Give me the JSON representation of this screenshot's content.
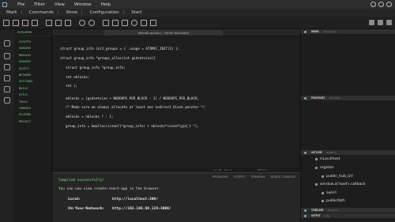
{
  "menubar": {
    "items": [
      "File",
      "Filter",
      "View",
      "Window",
      "Help"
    ]
  },
  "commandbar": {
    "items": [
      "Mark",
      "Commands",
      "Show",
      "Configuration",
      "Start"
    ]
  },
  "explorer": {
    "header": "EXPLORER",
    "items": [
      "SCRIPTS",
      "SHADERS",
      "MODULES",
      "SHADERS",
      "ASSETS",
      "NETWORK",
      "SETTINGS",
      "BUILD",
      "UTILS",
      "TOOLS",
      "CONSOLE",
      "PLUGINS",
      "PROJECT"
    ]
  },
  "editor": {
    "tab_title": "allocate-groups.c - kernel workspace",
    "lines": [
      "struct group_info init_groups = { .usage = ATOMIC_INIT(2) };",
      "struct group_info *groups_alloc(int gidsetsize){",
      "struct group_info *group_info;",
      "int nblocks;",
      "int i;",
      "nblocks = (gidsetsize + NGROUPS_PER_BLOCK - 1) / NGROUPS_PER_BLOCK;",
      "/* Make sure we always allocate at least one indirect block pointer */",
      "nblocks = nblocks ? : 1;",
      "group_info = kmalloc(sizeof(*group_info) + nblocks*sizeof(gid_t *),"
    ]
  },
  "status": {
    "left": "Ln 12, Col 4",
    "right": "UTF-8  C"
  },
  "panel": {
    "tabs": [
      "PROBLEMS",
      "OUTPUT",
      "TERMINAL",
      "DEBUG CONSOLE"
    ],
    "success": "Compiled successfully!",
    "message": "You can now view create-react-app in the browser.",
    "local_label": "Local:",
    "local_url": "http://localhost:300/",
    "network_label": "On Your Network:",
    "network_url": "http://192.168.98.138:3000/"
  },
  "rightpanel": {
    "sections": [
      {
        "title": "DEBUG",
        "sub": "Variables"
      },
      {
        "title": "PROCESSES",
        "sub": "Running"
      },
      {
        "title": "OUTLINE",
        "sub": "Symbols"
      },
      {
        "title": "TIMELINE",
        "sub": "History"
      },
      {
        "title": "OUTPUT",
        "sub": "Log"
      }
    ],
    "outline": [
      "isLocalhost",
      "register",
      "public_hub_Url",
      "window.a('load') callback",
      "swUrl",
      "publicPath"
    ]
  }
}
